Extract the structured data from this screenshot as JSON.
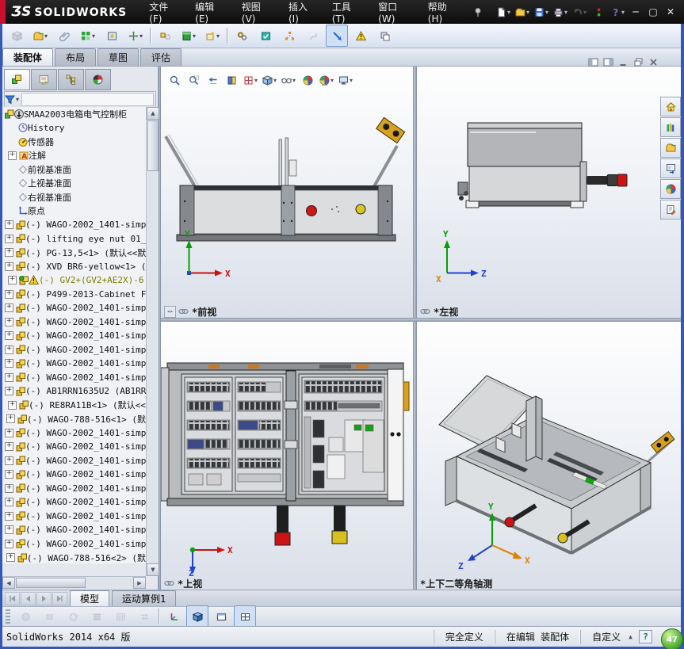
{
  "ui": {
    "dropdown_glyph": "▾",
    "expander_glyph": "+",
    "chevrons": "»",
    "corner_glyph": "◂▸"
  },
  "titlebar": {
    "brand_prefix": "ƷS",
    "brand": "SOLIDWORKS",
    "menus": [
      {
        "key": "file",
        "label": "文件(F)"
      },
      {
        "key": "edit",
        "label": "编辑(E)"
      },
      {
        "key": "view",
        "label": "视图(V)"
      },
      {
        "key": "insert",
        "label": "插入(I)"
      },
      {
        "key": "tools",
        "label": "工具(T)"
      },
      {
        "key": "window",
        "label": "窗口(W)"
      },
      {
        "key": "help",
        "label": "帮助(H)"
      }
    ],
    "window_buttons": [
      {
        "name": "minimize-window",
        "glyph": "─"
      },
      {
        "name": "maximize-window",
        "glyph": "▢"
      },
      {
        "name": "close-window",
        "glyph": "✕"
      }
    ]
  },
  "quick_access": [
    {
      "name": "new-document",
      "icon": "new-document",
      "dropdown": true
    },
    {
      "name": "open",
      "icon": "open-folder",
      "dropdown": true
    },
    {
      "name": "save",
      "icon": "save",
      "dropdown": true
    },
    {
      "name": "print",
      "icon": "print",
      "dropdown": true
    },
    {
      "name": "undo",
      "icon": "undo",
      "dropdown": true,
      "disabled": true
    },
    {
      "name": "options-traffic-light",
      "icon": "traffic-light"
    },
    {
      "name": "help",
      "icon": "help",
      "dropdown": true
    }
  ],
  "assembly_toolbar": [
    {
      "name": "edit-component",
      "icon": "cube-gray",
      "disabled": true
    },
    {
      "name": "insert-components",
      "icon": "open-folder",
      "dropdown": true
    },
    {
      "name": "mate",
      "icon": "paperclip"
    },
    {
      "name": "linear-component-pattern",
      "icon": "green-blocks",
      "dropdown": true
    },
    {
      "name": "smart-fasteners",
      "icon": "star-window"
    },
    {
      "name": "move-component",
      "icon": "move-cross",
      "dropdown": true
    },
    {
      "sep": true
    },
    {
      "name": "show-hidden-components",
      "icon": "show-hidden"
    },
    {
      "name": "assembly-features",
      "icon": "green-cabinet",
      "dropdown": true
    },
    {
      "name": "reference-geometry",
      "icon": "sparkle-box",
      "dropdown": true
    },
    {
      "sep": true
    },
    {
      "name": "motion-study",
      "icon": "gears"
    },
    {
      "name": "assemblyxpert",
      "icon": "xpert"
    },
    {
      "name": "exploded-view",
      "icon": "exploded"
    },
    {
      "name": "explode-line-sketch",
      "icon": "explode-lines",
      "disabled": true
    },
    {
      "name": "instant3d",
      "icon": "instant3d",
      "pressed": true
    },
    {
      "name": "interference-detection",
      "icon": "warn"
    },
    {
      "name": "isolate",
      "icon": "isolate"
    }
  ],
  "command_tabs": {
    "active": "装配体",
    "tabs": [
      "装配体",
      "布局",
      "草图",
      "评估"
    ]
  },
  "panel_tabs": [
    {
      "name": "featuremanager-tab",
      "icon": "featmgr",
      "active": true
    },
    {
      "name": "propertymanager-tab",
      "icon": "propmgr"
    },
    {
      "name": "configurationmanager-tab",
      "icon": "confmgr"
    },
    {
      "name": "displaymanager-tab",
      "icon": "dispmgr"
    }
  ],
  "headsup": [
    {
      "name": "zoom-to-fit",
      "icon": "zoom-fit"
    },
    {
      "name": "zoom-to-area",
      "icon": "zoom-area"
    },
    {
      "name": "previous-view",
      "icon": "prev-view"
    },
    {
      "name": "section-view",
      "icon": "section"
    },
    {
      "name": "view-orientation",
      "icon": "vieworient",
      "dropdown": true
    },
    {
      "name": "display-style",
      "icon": "cube-shaded",
      "dropdown": true
    },
    {
      "name": "hide-show-items",
      "icon": "glasses",
      "dropdown": true
    },
    {
      "name": "edit-appearance",
      "icon": "ball"
    },
    {
      "name": "apply-scene",
      "icon": "scene",
      "dropdown": true
    },
    {
      "name": "view-settings",
      "icon": "monitor",
      "dropdown": true
    }
  ],
  "doc_window_controls": [
    {
      "name": "previous-window",
      "icon": "win-prev"
    },
    {
      "name": "next-window",
      "icon": "win-next"
    },
    {
      "name": "minimize-document",
      "icon": "win-min"
    },
    {
      "name": "restore-document",
      "icon": "win-restore"
    },
    {
      "name": "close-document",
      "icon": "win-close"
    }
  ],
  "tree": {
    "rows": [
      {
        "label": "SMAA2003电箱电气控制柜",
        "icon": "assembly-root",
        "warn_down": true,
        "level": 0
      },
      {
        "label": "History",
        "icon": "history",
        "level": 1
      },
      {
        "label": "传感器",
        "icon": "sensors",
        "level": 1
      },
      {
        "label": "注解",
        "icon": "annotations",
        "level": 1,
        "expand": true
      },
      {
        "label": "前视基准面",
        "icon": "plane",
        "level": 1
      },
      {
        "label": "上视基准面",
        "icon": "plane",
        "level": 1
      },
      {
        "label": "右视基准面",
        "icon": "plane",
        "level": 1
      },
      {
        "label": "原点",
        "icon": "origin",
        "level": 1
      },
      {
        "label": "(-) WAGO-2002_1401-simp",
        "icon": "part",
        "level": 1,
        "expand": true
      },
      {
        "label": "(-) lifting eye nut 01_",
        "icon": "part",
        "level": 1,
        "expand": true
      },
      {
        "label": "(-) PG-13,5<1> (默认<<默",
        "icon": "part",
        "level": 1,
        "expand": true
      },
      {
        "label": "(-) XVD BR6-yellow<1> (",
        "icon": "part",
        "level": 1,
        "expand": true
      },
      {
        "label": "(-) GV2+(GV2+AE2X)-6",
        "icon": "part-green",
        "level": 1,
        "expand": true,
        "warn": true,
        "selected": true
      },
      {
        "label": "(-) P499-2013-Cabinet F",
        "icon": "part",
        "level": 1,
        "expand": true
      },
      {
        "label": "(-) WAGO-2002_1401-simp",
        "icon": "part",
        "level": 1,
        "expand": true
      },
      {
        "label": "(-) WAGO-2002_1401-simp",
        "icon": "part",
        "level": 1,
        "expand": true
      },
      {
        "label": "(-) WAGO-2002_1401-simp",
        "icon": "part",
        "level": 1,
        "expand": true
      },
      {
        "label": "(-) WAGO-2002_1401-simp",
        "icon": "part",
        "level": 1,
        "expand": true
      },
      {
        "label": "(-) WAGO-2002_1401-simp",
        "icon": "part",
        "level": 1,
        "expand": true
      },
      {
        "label": "(-) WAGO-2002_1401-simp",
        "icon": "part",
        "level": 1,
        "expand": true
      },
      {
        "label": "(-) AB1RRN1635U2 (AB1RRN",
        "icon": "part",
        "level": 1,
        "expand": true
      },
      {
        "label": "(-) RE8RA11B<1> (默认<<",
        "icon": "part",
        "level": 1,
        "expand": true
      },
      {
        "label": "(-) WAGO-788-516<1> (默",
        "icon": "part",
        "level": 1,
        "expand": true
      },
      {
        "label": "(-) WAGO-2002_1401-simp",
        "icon": "part",
        "level": 1,
        "expand": true
      },
      {
        "label": "(-) WAGO-2002_1401-simp",
        "icon": "part",
        "level": 1,
        "expand": true
      },
      {
        "label": "(-) WAGO-2002_1401-simp",
        "icon": "part",
        "level": 1,
        "expand": true
      },
      {
        "label": "(-) WAGO-2002_1401-simp",
        "icon": "part",
        "level": 1,
        "expand": true
      },
      {
        "label": "(-) WAGO-2002_1401-simp",
        "icon": "part",
        "level": 1,
        "expand": true
      },
      {
        "label": "(-) WAGO-2002_1401-simp",
        "icon": "part",
        "level": 1,
        "expand": true
      },
      {
        "label": "(-) WAGO-2002_1401-simp",
        "icon": "part",
        "level": 1,
        "expand": true
      },
      {
        "label": "(-) WAGO-2002_1401-simp",
        "icon": "part",
        "level": 1,
        "expand": true
      },
      {
        "label": "(-) WAGO-2002_1401-simp",
        "icon": "part",
        "level": 1,
        "expand": true
      },
      {
        "label": "(-) WAGO-788-516<2> (默",
        "icon": "part",
        "level": 1,
        "expand": true
      }
    ]
  },
  "viewports": [
    {
      "label": "*前视",
      "linked": true,
      "triad": [
        "Y",
        "X"
      ]
    },
    {
      "label": "*左视",
      "linked": true,
      "triad": [
        "Y",
        "Z",
        "X"
      ]
    },
    {
      "label": "*上视",
      "linked": true,
      "triad": [
        "X",
        "Z"
      ]
    },
    {
      "label": "*上下二等角轴测",
      "linked": false,
      "triad": [
        "Y",
        "Z",
        "X"
      ]
    }
  ],
  "task_pane": [
    {
      "name": "solidworks-resources",
      "icon": "home"
    },
    {
      "name": "design-library",
      "icon": "design-library"
    },
    {
      "name": "file-explorer",
      "icon": "open-folder"
    },
    {
      "name": "view-palette",
      "icon": "view-palette"
    },
    {
      "name": "appearances-scenes",
      "icon": "ball"
    },
    {
      "name": "custom-properties",
      "icon": "custom-properties"
    }
  ],
  "model_tabs": {
    "nav": [
      {
        "name": "first-tab",
        "icon": "nav-first"
      },
      {
        "name": "previous-tab",
        "icon": "nav-prev"
      },
      {
        "name": "next-tab",
        "icon": "nav-next"
      },
      {
        "name": "last-tab",
        "icon": "nav-last"
      }
    ],
    "tabs": [
      "模型",
      "运动算例1"
    ],
    "active": "模型"
  },
  "motion_toolbar": [
    {
      "name": "filter-animation",
      "icon": "g-disc",
      "disabled": true
    },
    {
      "name": "filter-driving",
      "icon": "g-stack",
      "disabled": true
    },
    {
      "name": "filter-rotate",
      "icon": "g-rot",
      "disabled": true
    },
    {
      "name": "filter-results",
      "icon": "g-list",
      "disabled": true
    },
    {
      "name": "table-grid",
      "icon": "g-grid",
      "disabled": true
    },
    {
      "name": "link-views",
      "icon": "g-swap",
      "disabled": true
    },
    {
      "sep": true
    },
    {
      "name": "axes-visibility",
      "icon": "axes-legend"
    },
    {
      "name": "isometric-viewport",
      "icon": "cube-blue",
      "pressed": true
    },
    {
      "name": "single-viewport",
      "icon": "single-view"
    },
    {
      "name": "four-viewport",
      "icon": "four-view",
      "pressed": true
    }
  ],
  "status_bar": {
    "left": "SolidWorks 2014 x64 版",
    "panes": [
      "完全定义",
      "在编辑 装配体",
      "自定义"
    ],
    "dropdown_arrow": "▲",
    "help": "?",
    "overlay_badge": "47"
  }
}
